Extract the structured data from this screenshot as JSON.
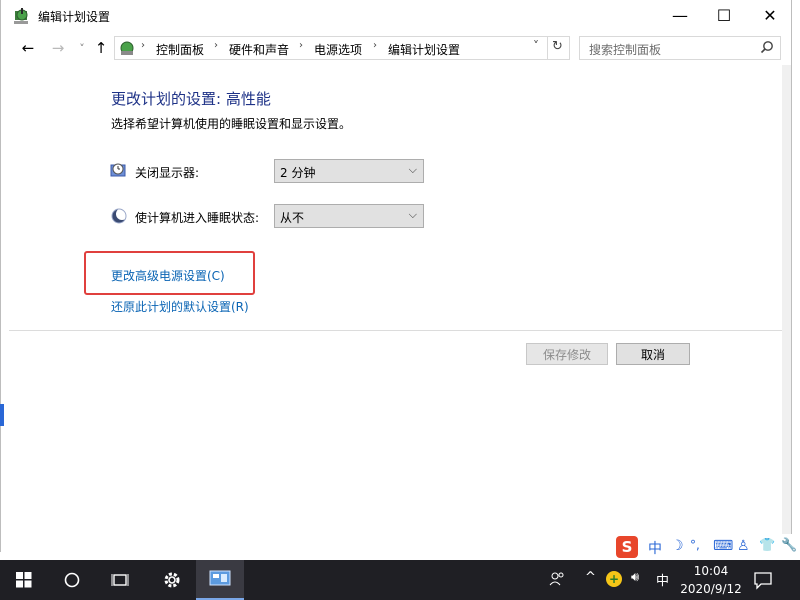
{
  "window": {
    "title": "编辑计划设置",
    "controls": {
      "minimize": "—",
      "maximize": "☐",
      "close": "✕"
    }
  },
  "nav": {
    "back": "←",
    "forward": "→",
    "recent": "˅",
    "up": "↑",
    "breadcrumbs": [
      "控制面板",
      "硬件和声音",
      "电源选项",
      "编辑计划设置"
    ],
    "dropdown": "˅",
    "refresh": "↻"
  },
  "search": {
    "placeholder": "搜索控制面板"
  },
  "content": {
    "heading": "更改计划的设置: 高性能",
    "subtitle": "选择希望计算机使用的睡眠设置和显示设置。",
    "display_off": {
      "label": "关闭显示器:",
      "value": "2 分钟"
    },
    "sleep": {
      "label": "使计算机进入睡眠状态:",
      "value": "从不"
    },
    "advanced_link": "更改高级电源设置(C)",
    "restore_link": "还原此计划的默认设置(R)",
    "save_button": "保存修改",
    "cancel_button": "取消"
  },
  "ime": {
    "lang": "中",
    "moon": "☽",
    "punct": "°,",
    "keyboard": "⌨",
    "person": "♙",
    "shirt": "👕",
    "wrench": "🔧"
  },
  "taskbar": {
    "tray_lang": "中",
    "time": "10:04",
    "date": "2020/9/12"
  },
  "colors": {
    "heading": "#1e3287",
    "link": "#0a64b4",
    "highlight": "#e0403e",
    "taskbar": "#1f1f24"
  }
}
